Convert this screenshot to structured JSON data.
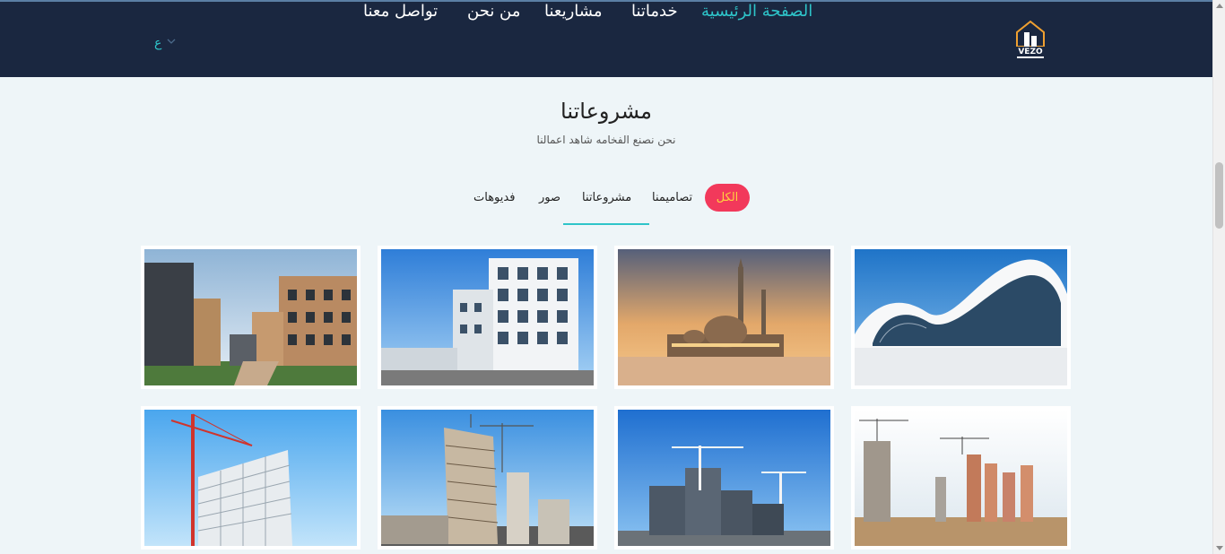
{
  "header": {
    "logo_text": "VEZO",
    "nav": [
      {
        "label": "الصفحة الرئيسية",
        "active": true
      },
      {
        "label": "خدماتنا",
        "active": false
      },
      {
        "label": "مشاريعنا",
        "active": false
      },
      {
        "label": "من نحن",
        "active": false
      },
      {
        "label": "تواصل معنا",
        "active": false
      }
    ],
    "language": "ع"
  },
  "section": {
    "title": "مشروعاتنا",
    "subtitle": "نحن نصنع الفخامه شاهد اعمالنا"
  },
  "filters": [
    {
      "label": "الكل",
      "active": true
    },
    {
      "label": "تصاميمنا",
      "active": false
    },
    {
      "label": "مشروعاتنا",
      "active": false
    },
    {
      "label": "صور",
      "active": false
    },
    {
      "label": "فديوهات",
      "active": false
    }
  ],
  "gallery": [
    {
      "name": "curved-white-building-image"
    },
    {
      "name": "mosque-sunset-image"
    },
    {
      "name": "white-apartment-block-image"
    },
    {
      "name": "residential-complex-image"
    },
    {
      "name": "construction-site-cranes-image"
    },
    {
      "name": "apartment-construction-image"
    },
    {
      "name": "high-rise-construction-image"
    },
    {
      "name": "tower-crane-building-image"
    }
  ],
  "colors": {
    "header_bg": "#1a2740",
    "accent": "#2ec4c9",
    "filter_active_bg": "#f2395b",
    "filter_active_text": "#ffd23f",
    "page_bg": "#eef5f8"
  }
}
